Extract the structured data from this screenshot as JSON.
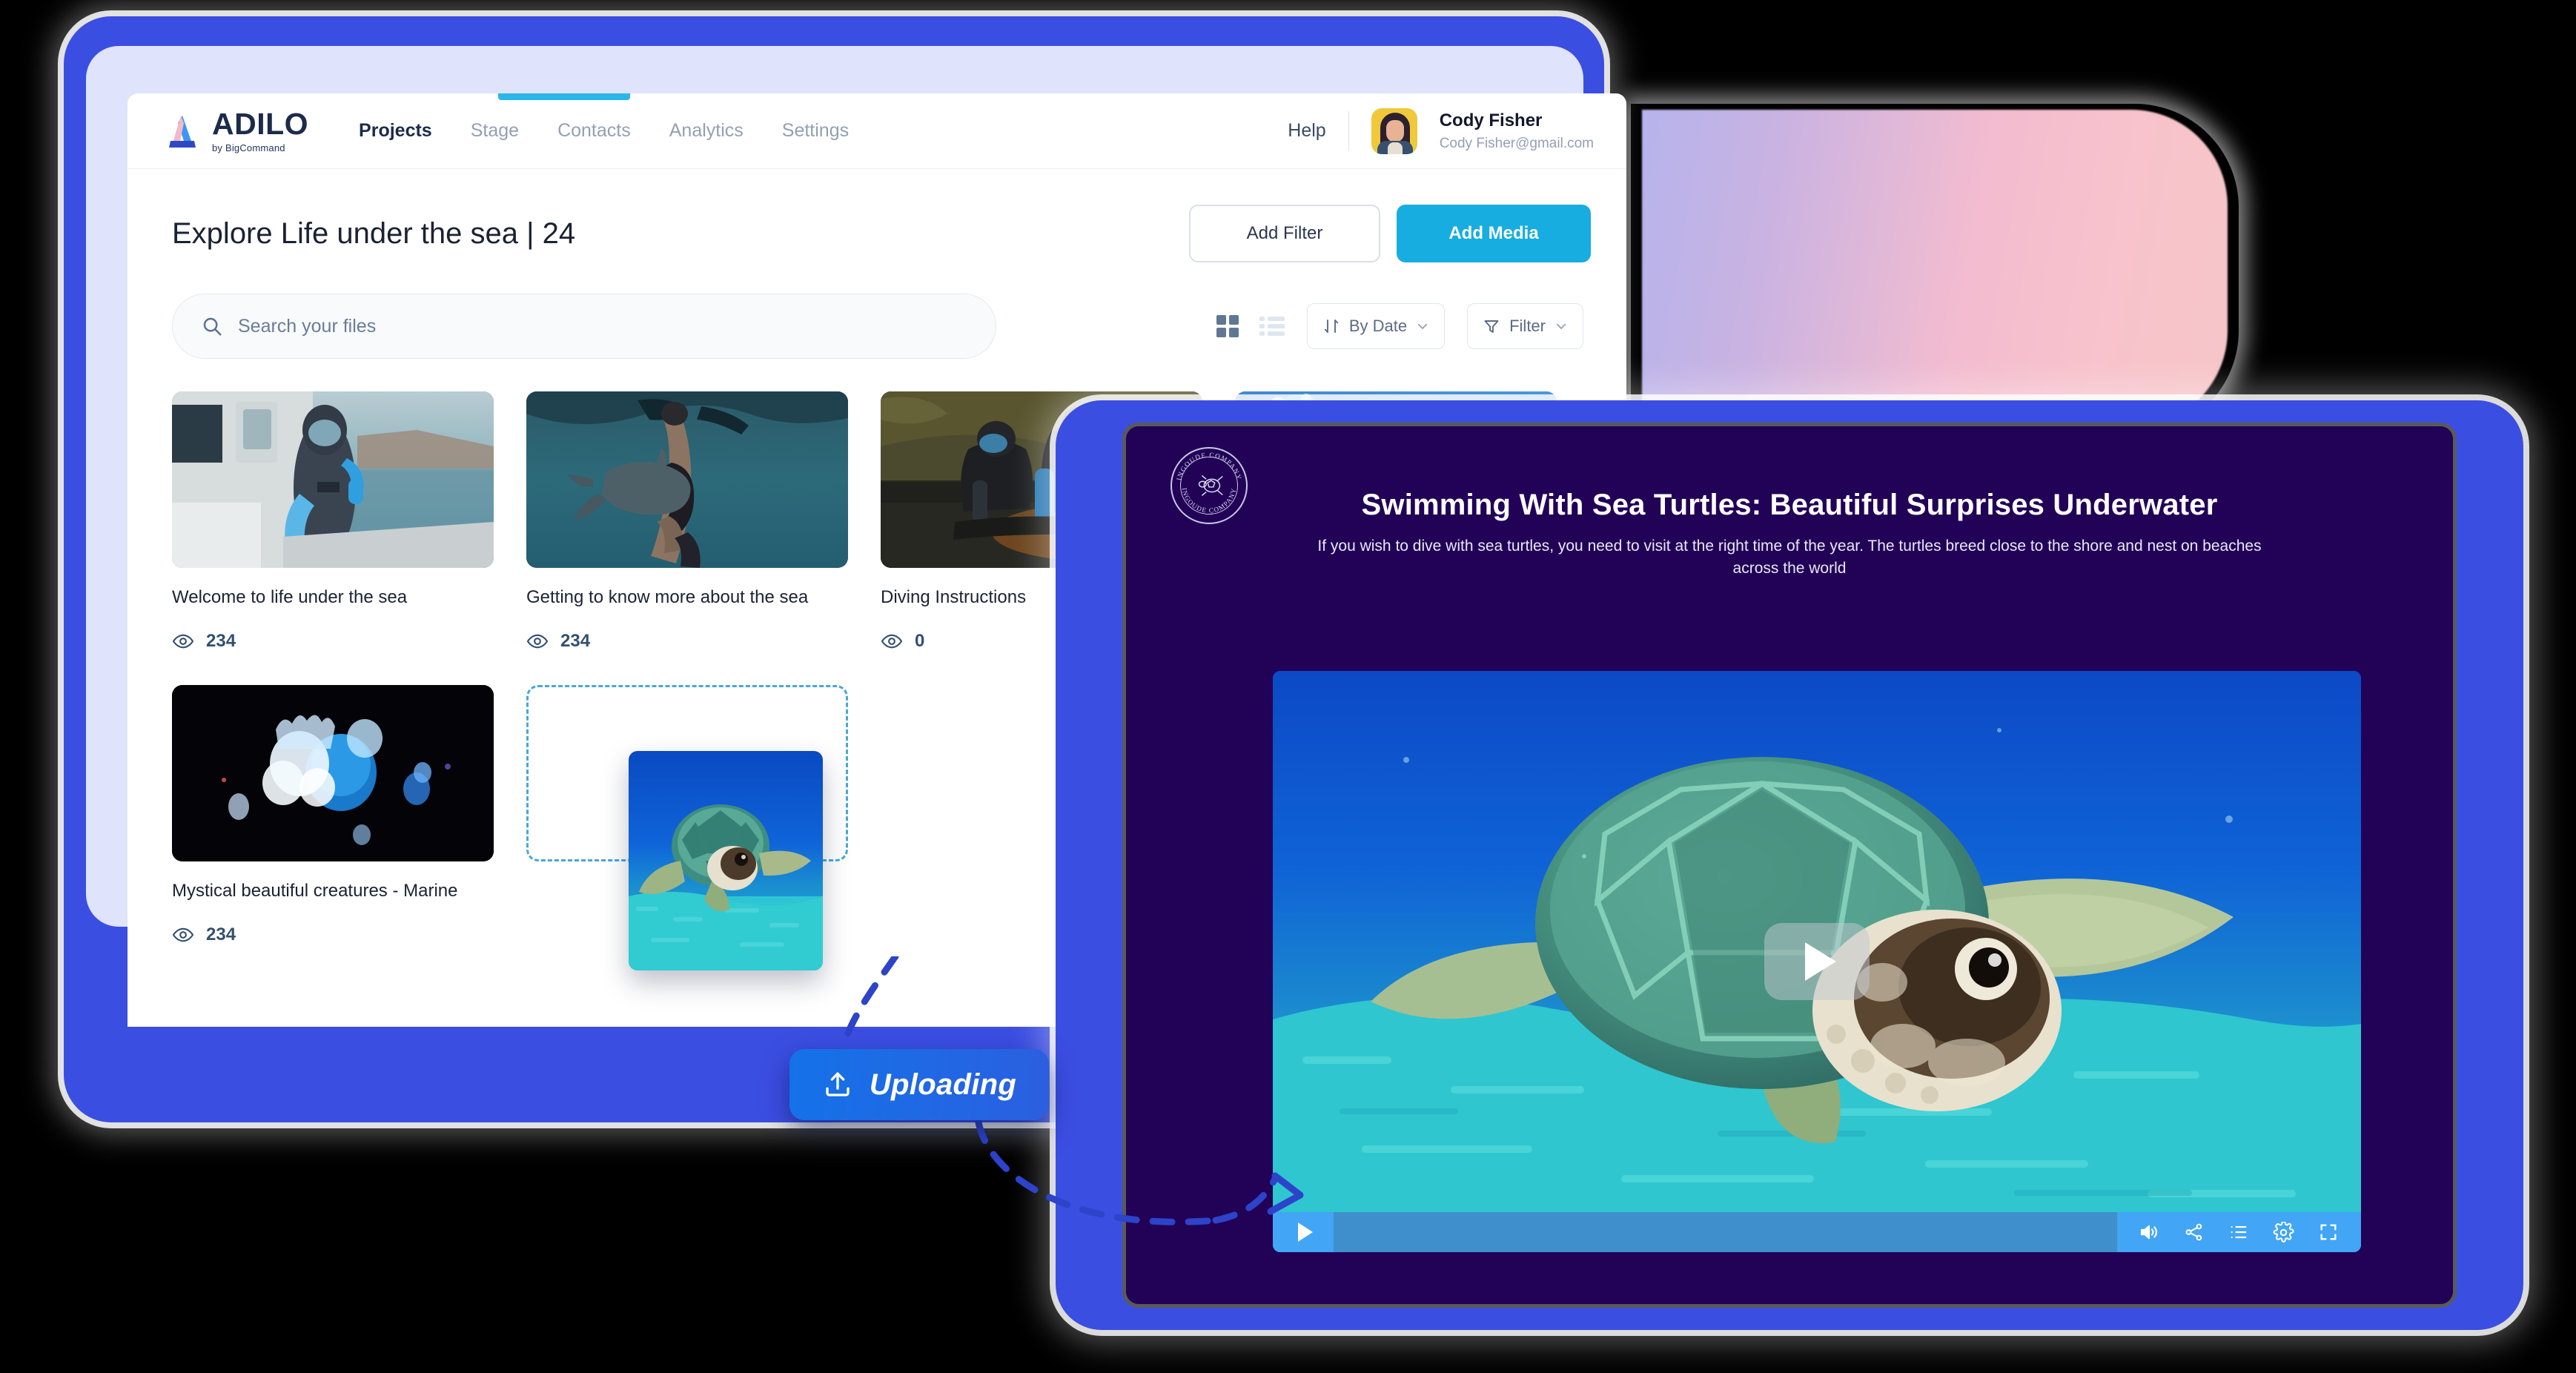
{
  "app": {
    "logo": {
      "word": "ADILO",
      "sub": "by BigCommand",
      "mark": "adilo-triangle-logo"
    },
    "nav": [
      {
        "label": "Projects",
        "active": true
      },
      {
        "label": "Stage",
        "active": false
      },
      {
        "label": "Contacts",
        "active": false
      },
      {
        "label": "Analytics",
        "active": false
      },
      {
        "label": "Settings",
        "active": false
      }
    ],
    "help_label": "Help",
    "user": {
      "name": "Cody Fisher",
      "email": "Cody Fisher@gmail.com",
      "avatar": "user-avatar-photo"
    }
  },
  "page": {
    "title": "Explore Life under the sea | 24",
    "add_filter_label": "Add Filter",
    "add_media_label": "Add Media"
  },
  "search": {
    "placeholder": "Search your files",
    "value": "",
    "icon": "search-icon"
  },
  "toolbar": {
    "grid_view": {
      "icon": "grid-view-icon",
      "active": true
    },
    "list_view": {
      "icon": "list-view-icon",
      "active": false
    },
    "sort": {
      "icon": "sort-icon",
      "label": "By Date",
      "caret": "chevron-down-icon"
    },
    "filter": {
      "icon": "funnel-icon",
      "label": "Filter",
      "caret": "chevron-down-icon"
    }
  },
  "media": {
    "view_icon": "eye-icon",
    "items": [
      {
        "title": "Welcome to life under the sea",
        "views": "234",
        "thumb": "diver-on-boat-thumbnail"
      },
      {
        "title": "Getting to know more about the sea",
        "views": "234",
        "thumb": "freediver-with-shark-thumbnail"
      },
      {
        "title": "Diving Instructions",
        "views": "0",
        "thumb": "divers-on-shore-thumbnail"
      },
      {
        "title": "",
        "views": "",
        "thumb": "scuba-diver-reef-thumbnail"
      },
      {
        "title": "Mystical beautiful creatures - Marine",
        "views": "234",
        "thumb": "jellyfish-thumbnail"
      }
    ],
    "dropzone": {
      "name": "upload-dropzone"
    },
    "dragged_file": {
      "thumb": "sea-turtle-thumbnail"
    }
  },
  "upload_badge": {
    "label": "Uploading",
    "icon": "upload-icon"
  },
  "video_panel": {
    "brand_seal": {
      "text": "INGOUDE COMPANY",
      "icon": "turtle-seal-icon"
    },
    "title": "Swimming With Sea Turtles: Beautiful Surprises Underwater",
    "subtitle": "If you wish to dive with sea turtles, you need to visit at the right time of the year. The turtles breed close to the shore and nest on beaches across the world",
    "poster": "sea-turtle-underwater-poster",
    "play_overlay": {
      "icon": "play-icon"
    },
    "controls": {
      "play": {
        "icon": "play-icon"
      },
      "progress": {
        "value": 0
      },
      "volume": {
        "icon": "volume-icon"
      },
      "share": {
        "icon": "share-icon"
      },
      "playlist": {
        "icon": "playlist-icon"
      },
      "settings": {
        "icon": "gear-icon"
      },
      "fullscreen": {
        "icon": "fullscreen-icon"
      }
    }
  },
  "colors": {
    "accent_blue": "#18ade0",
    "frame_blue": "#3b4ee2",
    "upload_blue": "#1472e8",
    "panel_purple": "#220257",
    "player_blue": "#42a5f5",
    "tab_indicator": "#29b6e8"
  }
}
